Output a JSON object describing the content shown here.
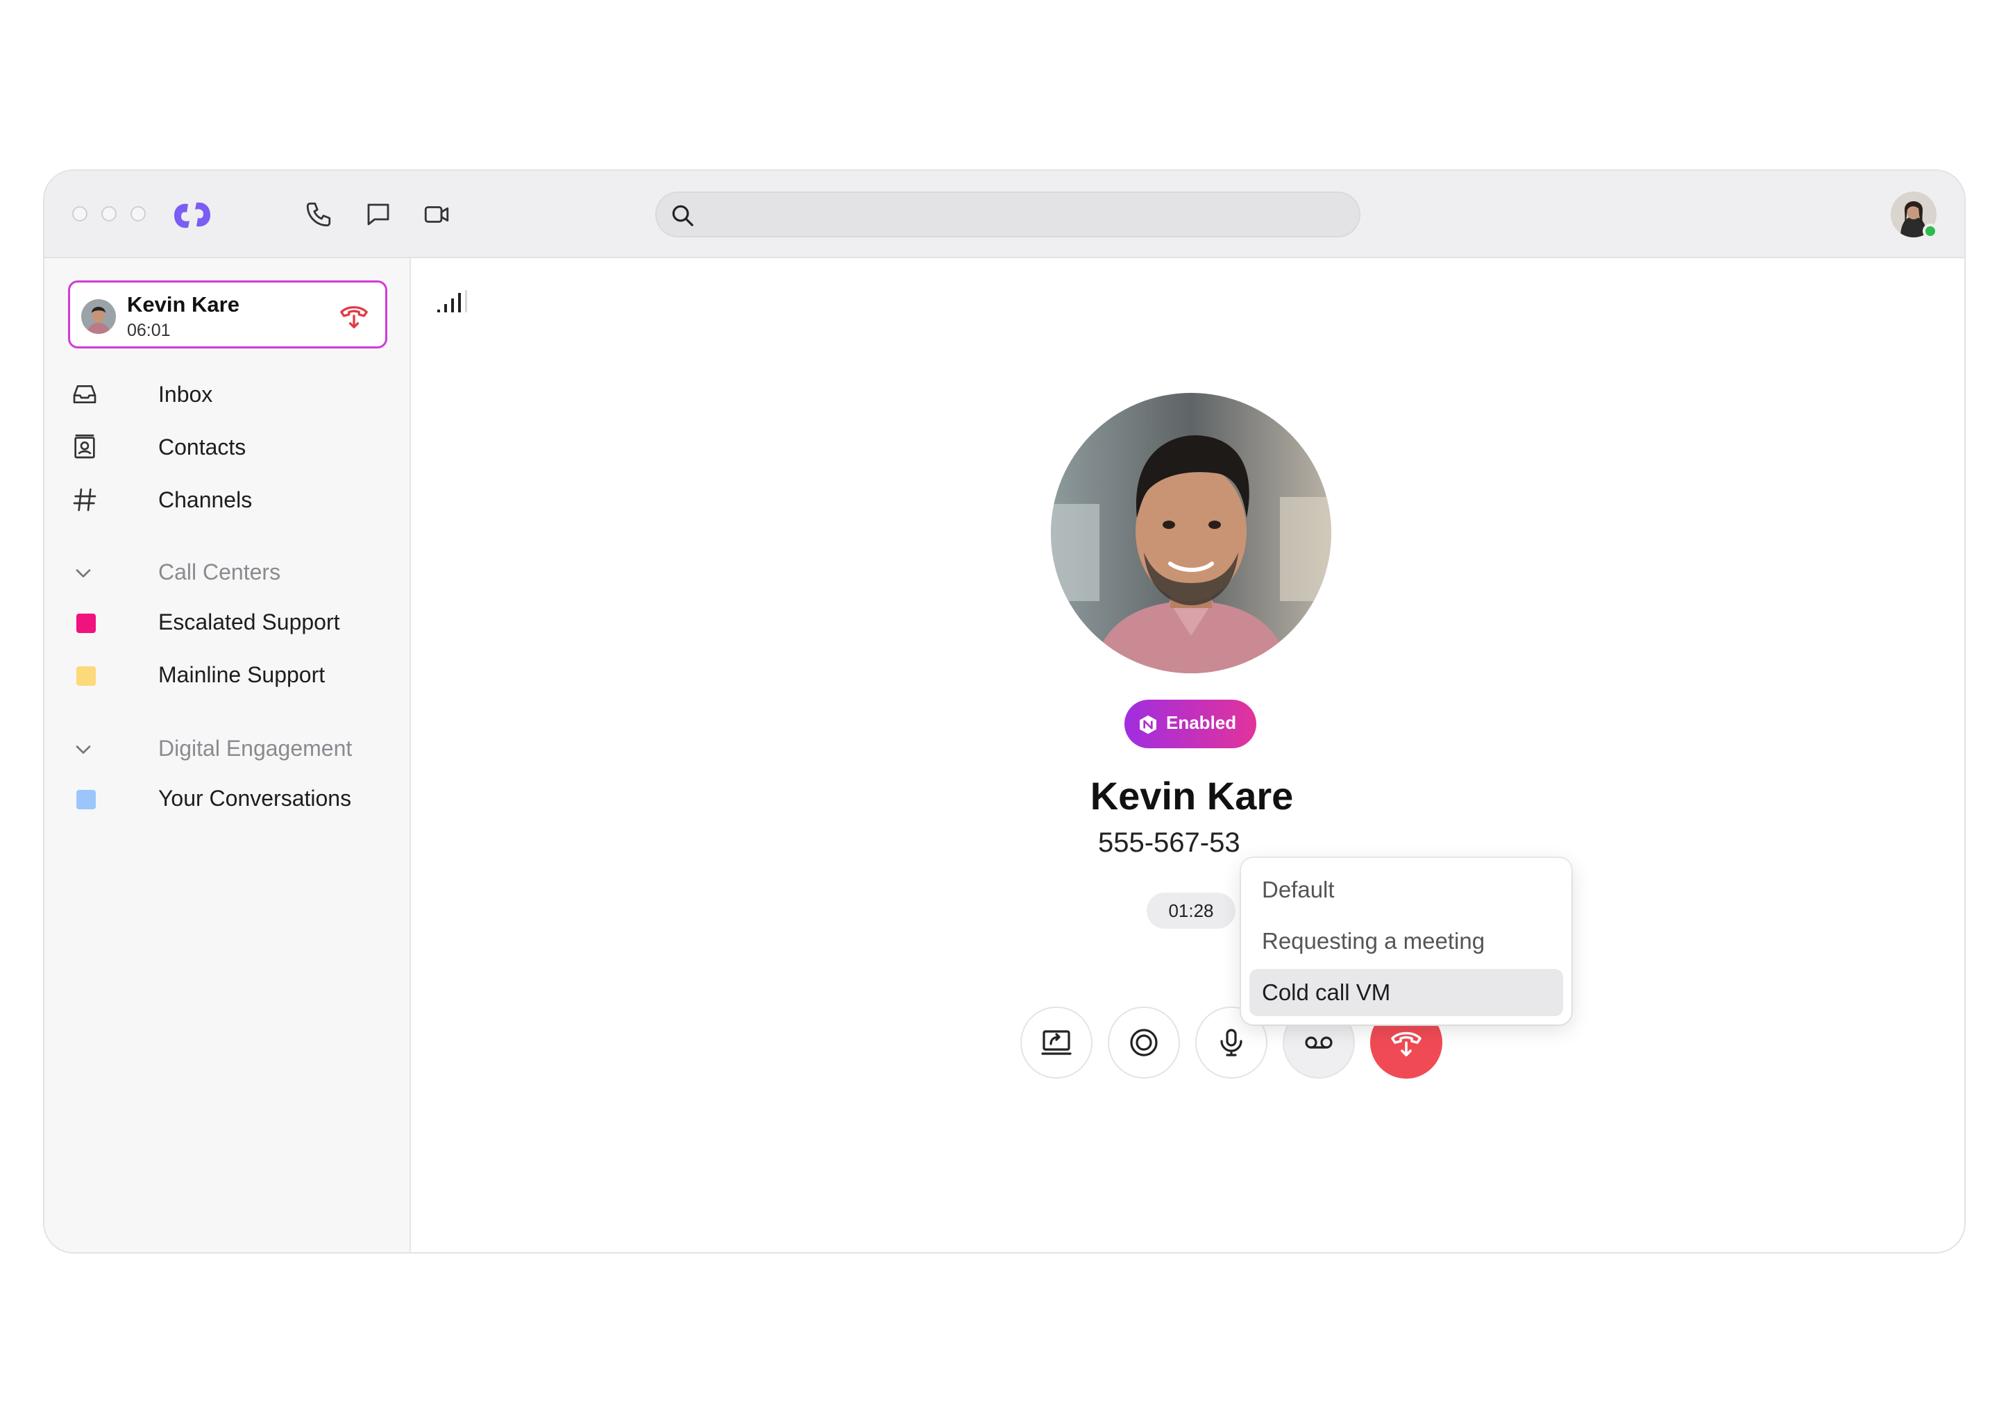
{
  "topbar": {
    "search": {
      "placeholder": "",
      "value": ""
    },
    "icons": [
      "phone-icon",
      "chat-icon",
      "video-icon"
    ]
  },
  "sidebar": {
    "active_call": {
      "name": "Kevin Kare",
      "duration": "06:01"
    },
    "nav": [
      {
        "label": "Inbox",
        "icon": "inbox-icon"
      },
      {
        "label": "Contacts",
        "icon": "contacts-icon"
      },
      {
        "label": "Channels",
        "icon": "hash-icon"
      }
    ],
    "sections": [
      {
        "title": "Call Centers",
        "items": [
          {
            "label": "Escalated Support",
            "color": "#f0127e"
          },
          {
            "label": "Mainline Support",
            "color": "#fcd97a"
          }
        ]
      },
      {
        "title": "Digital Engagement",
        "items": [
          {
            "label": "Your Conversations",
            "color": "#9cc6fb"
          }
        ]
      }
    ]
  },
  "call": {
    "badge": "Enabled",
    "caller_name": "Kevin Kare",
    "caller_number": "555-567-53",
    "timer": "01:28"
  },
  "voicemail_menu": {
    "options": [
      "Default",
      "Requesting a meeting",
      "Cold call VM"
    ],
    "selected": "Cold call VM"
  },
  "colors": {
    "accent": "#7b5cf5",
    "active_border": "#d33ad9",
    "end_call": "#f04b55",
    "online": "#2bbd4e"
  }
}
